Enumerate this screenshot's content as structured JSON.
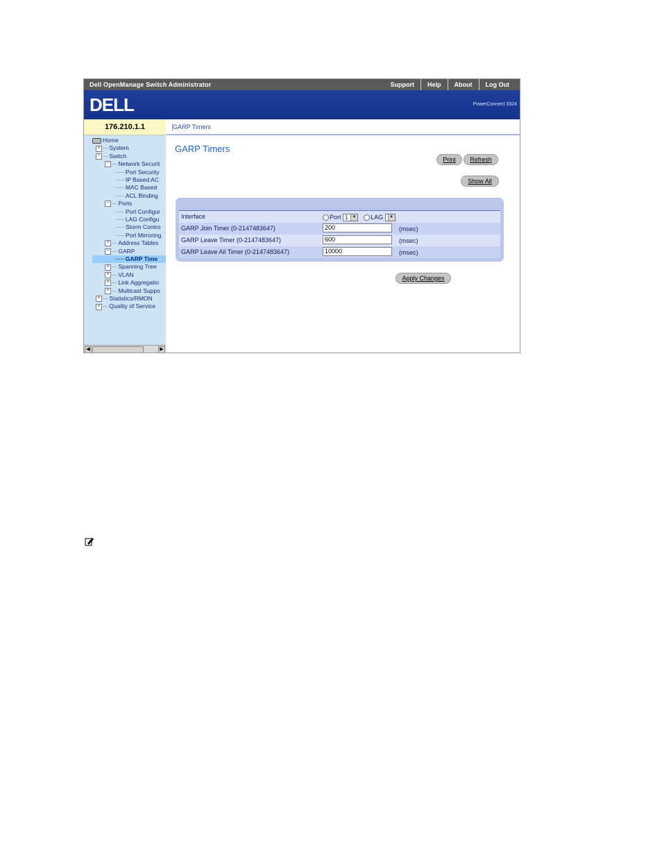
{
  "window": {
    "app_title": "Dell OpenManage Switch Administrator",
    "top_nav": [
      "Support",
      "Help",
      "About",
      "Log Out"
    ],
    "brand": "DELL",
    "model": "PowerConnect 3324",
    "ip": "176.210.1.1",
    "breadcrumb": "GARP Timers"
  },
  "tree": [
    {
      "label": "Home",
      "level": 0,
      "exp": "",
      "icon": "home-icon"
    },
    {
      "label": "System",
      "level": 1,
      "exp": "+"
    },
    {
      "label": "Switch",
      "level": 1,
      "exp": "-"
    },
    {
      "label": "Network Securit",
      "level": 2,
      "exp": "-"
    },
    {
      "label": "Port Security",
      "level": 3,
      "exp": ""
    },
    {
      "label": "IP Based AC",
      "level": 3,
      "exp": ""
    },
    {
      "label": "MAC Based",
      "level": 3,
      "exp": ""
    },
    {
      "label": "ACL Binding",
      "level": 3,
      "exp": ""
    },
    {
      "label": "Ports",
      "level": 2,
      "exp": "-"
    },
    {
      "label": "Port Configur",
      "level": 3,
      "exp": ""
    },
    {
      "label": "LAG Configu",
      "level": 3,
      "exp": ""
    },
    {
      "label": "Storm Contro",
      "level": 3,
      "exp": ""
    },
    {
      "label": "Port Mirroring",
      "level": 3,
      "exp": ""
    },
    {
      "label": "Address Tables",
      "level": 2,
      "exp": "+"
    },
    {
      "label": "GARP",
      "level": 2,
      "exp": "-"
    },
    {
      "label": "GARP Time",
      "level": 3,
      "exp": "",
      "selected": true
    },
    {
      "label": "Spanning Tree",
      "level": 2,
      "exp": "+"
    },
    {
      "label": "VLAN",
      "level": 2,
      "exp": "+"
    },
    {
      "label": "Link Aggregatio",
      "level": 2,
      "exp": "+"
    },
    {
      "label": "Multicast Suppo",
      "level": 2,
      "exp": "+"
    },
    {
      "label": "Statistics/RMON",
      "level": 1,
      "exp": "+"
    },
    {
      "label": "Quality of Service",
      "level": 1,
      "exp": "+"
    }
  ],
  "page": {
    "title": "GARP Timers",
    "buttons": {
      "print": "Print",
      "refresh": "Refresh",
      "show_all": "Show All",
      "apply": "Apply Changes"
    },
    "form": {
      "interface_label": "Interface",
      "port_label": "Port",
      "port_value": "1",
      "lag_label": "LAG",
      "lag_value": "",
      "join_label": "GARP Join Timer (0-2147483647)",
      "join_value": "200",
      "leave_label": "GARP Leave Timer (0-2147483647)",
      "leave_value": "600",
      "leaveall_label": "GARP Leave All Timer (0-2147483647)",
      "leaveall_value": "10000",
      "unit": "(msec)"
    }
  },
  "colors": {
    "banner": "#16328a",
    "sidebar": "#cde3f6",
    "panel": "#bcc5ea",
    "title": "#1e63b5"
  }
}
